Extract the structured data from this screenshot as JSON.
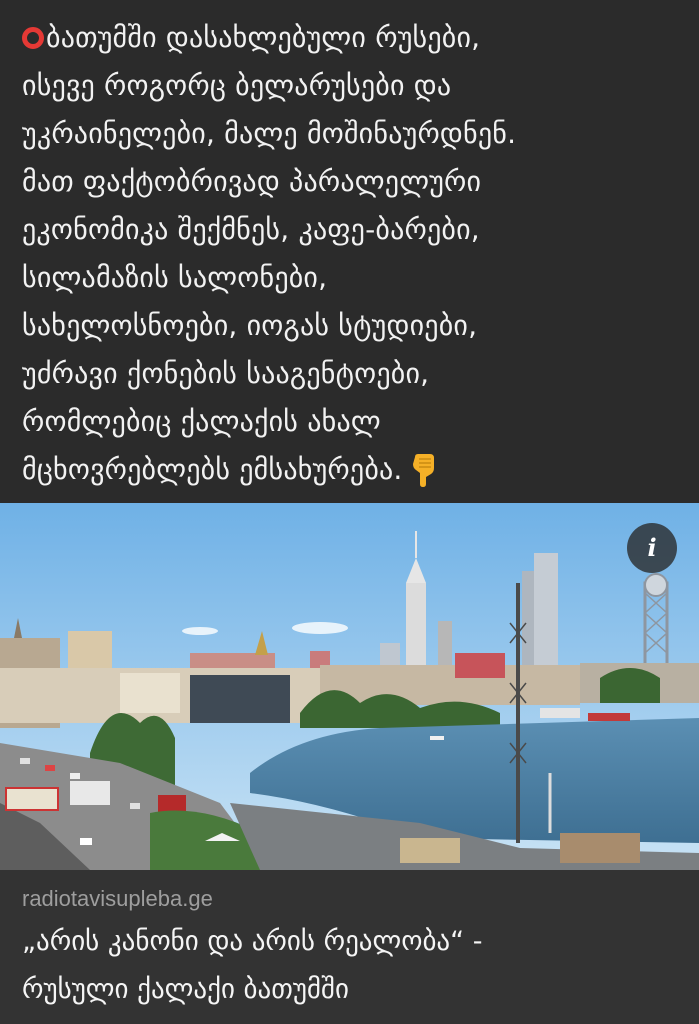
{
  "post": {
    "lines": [
      "ბათუმში დასახლებული რუსები,",
      "ისევე როგორც ბელარუსები და",
      "უკრაინელები, მალე მოშინაურდნენ.",
      "მათ ფაქტობრივად პარალელური",
      "ეკონომიკა შექმნეს, კაფე-ბარები,",
      "სილამაზის სალონები,",
      "სახელოსნოები, იოგას სტუდიები,",
      "უძრავი ქონების სააგენტოები,",
      "რომლებიც ქალაქის ახალ",
      "მცხოვრებლებს ემსახურება."
    ],
    "leading_icon": "red-circle-icon",
    "trailing_icon": "backhand-pointing-down-icon"
  },
  "photo": {
    "info_label": "i",
    "subject": "batumi-waterfront-photo"
  },
  "link_preview": {
    "domain": "radiotavisupleba.ge",
    "title_lines": [
      "„არის კანონი და არის რეალობა“ -",
      "რუსული ქალაქი ბათუმში"
    ]
  },
  "colors": {
    "background": "#2b2b2b",
    "card": "#333333",
    "text": "#f2f2f2",
    "domain": "#9e9e9e",
    "ring": "#e53935"
  }
}
